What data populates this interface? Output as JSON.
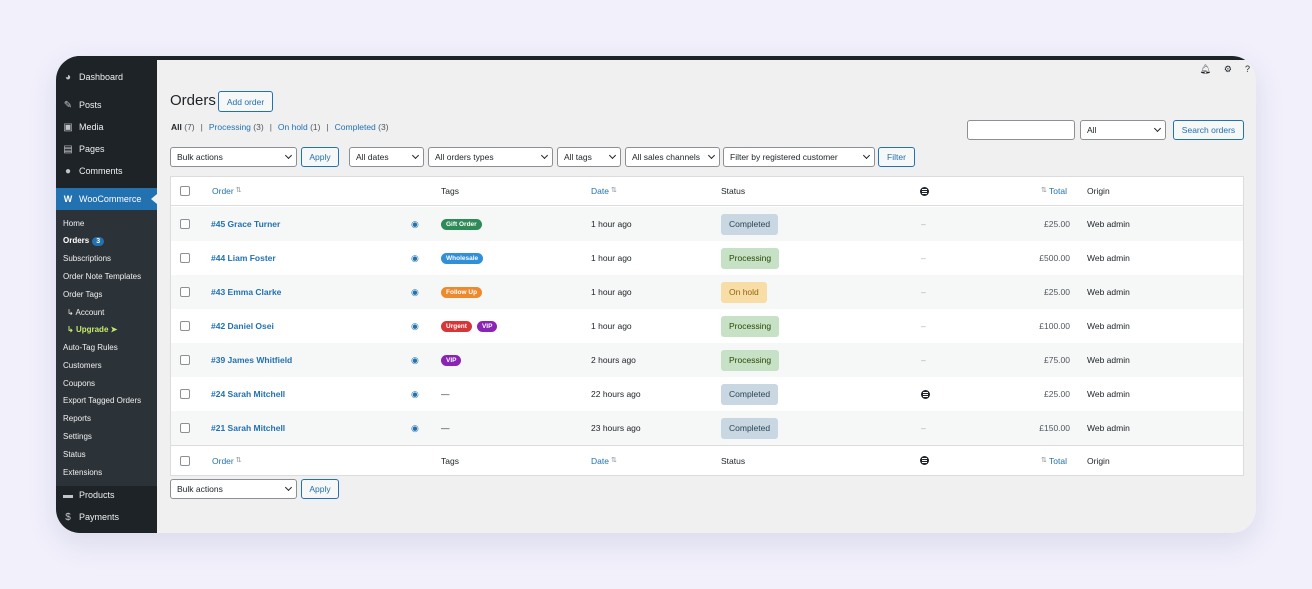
{
  "sidebar": {
    "dashboard": "Dashboard",
    "posts": "Posts",
    "media": "Media",
    "pages": "Pages",
    "comments": "Comments",
    "woocommerce": "WooCommerce",
    "sub": {
      "home": "Home",
      "orders": "Orders",
      "orders_count": "3",
      "subscriptions": "Subscriptions",
      "order_note_templates": "Order Note Templates",
      "order_tags": "Order Tags",
      "account": "Account",
      "upgrade": "Upgrade",
      "auto_tag_rules": "Auto-Tag Rules",
      "customers": "Customers",
      "coupons": "Coupons",
      "export_tagged_orders": "Export Tagged Orders",
      "reports": "Reports",
      "settings": "Settings",
      "status": "Status",
      "extensions": "Extensions"
    },
    "products": "Products",
    "payments": "Payments"
  },
  "page": {
    "title": "Orders",
    "add_order": "Add order"
  },
  "status_filters": [
    {
      "label": "All",
      "count": "(7)"
    },
    {
      "label": "Processing",
      "count": "(3)"
    },
    {
      "label": "On hold",
      "count": "(1)"
    },
    {
      "label": "Completed",
      "count": "(3)"
    }
  ],
  "search": {
    "select_value": "All",
    "button": "Search orders"
  },
  "filters": {
    "bulk_actions": "Bulk actions",
    "apply": "Apply",
    "dates": "All dates",
    "order_types": "All orders types",
    "tags": "All tags",
    "sales_channels": "All sales channels",
    "customer": "Filter by registered customer",
    "filter_button": "Filter"
  },
  "table": {
    "headers": {
      "order": "Order",
      "tags": "Tags",
      "date": "Date",
      "status": "Status",
      "total": "Total",
      "origin": "Origin"
    },
    "rows": [
      {
        "order": "#45 Grace Turner",
        "tags": [
          {
            "label": "Gift Order",
            "color": "#2e8b57"
          }
        ],
        "date": "1 hour ago",
        "status": "Completed",
        "cls": "st-completed",
        "origin_icon": false,
        "total": "£25.00",
        "origin": "Web admin"
      },
      {
        "order": "#44 Liam Foster",
        "tags": [
          {
            "label": "Wholesale",
            "color": "#2f8fd8"
          }
        ],
        "date": "1 hour ago",
        "status": "Processing",
        "cls": "st-processing",
        "origin_icon": false,
        "total": "£500.00",
        "origin": "Web admin"
      },
      {
        "order": "#43 Emma Clarke",
        "tags": [
          {
            "label": "Follow Up",
            "color": "#ee8a2e"
          }
        ],
        "date": "1 hour ago",
        "status": "On hold",
        "cls": "st-onhold",
        "origin_icon": false,
        "total": "£25.00",
        "origin": "Web admin"
      },
      {
        "order": "#42 Daniel Osei",
        "tags": [
          {
            "label": "Urgent",
            "color": "#d63638"
          },
          {
            "label": "VIP",
            "color": "#8a24b5"
          }
        ],
        "date": "1 hour ago",
        "status": "Processing",
        "cls": "st-processing",
        "origin_icon": false,
        "total": "£100.00",
        "origin": "Web admin"
      },
      {
        "order": "#39 James Whitfield",
        "tags": [
          {
            "label": "VIP",
            "color": "#8a24b5"
          }
        ],
        "date": "2 hours ago",
        "status": "Processing",
        "cls": "st-processing",
        "origin_icon": false,
        "total": "£75.00",
        "origin": "Web admin"
      },
      {
        "order": "#24 Sarah Mitchell",
        "tags": [],
        "date": "22 hours ago",
        "status": "Completed",
        "cls": "st-completed",
        "origin_icon": true,
        "total": "£25.00",
        "origin": "Web admin"
      },
      {
        "order": "#21 Sarah Mitchell",
        "tags": [],
        "date": "23 hours ago",
        "status": "Completed",
        "cls": "st-completed",
        "origin_icon": false,
        "total": "£150.00",
        "origin": "Web admin"
      }
    ],
    "empty_tag": "—",
    "empty_origin": "–"
  },
  "colors": {
    "accent": "#2271b1",
    "sidebar": "#1d2327",
    "submenu": "#2c3338"
  }
}
